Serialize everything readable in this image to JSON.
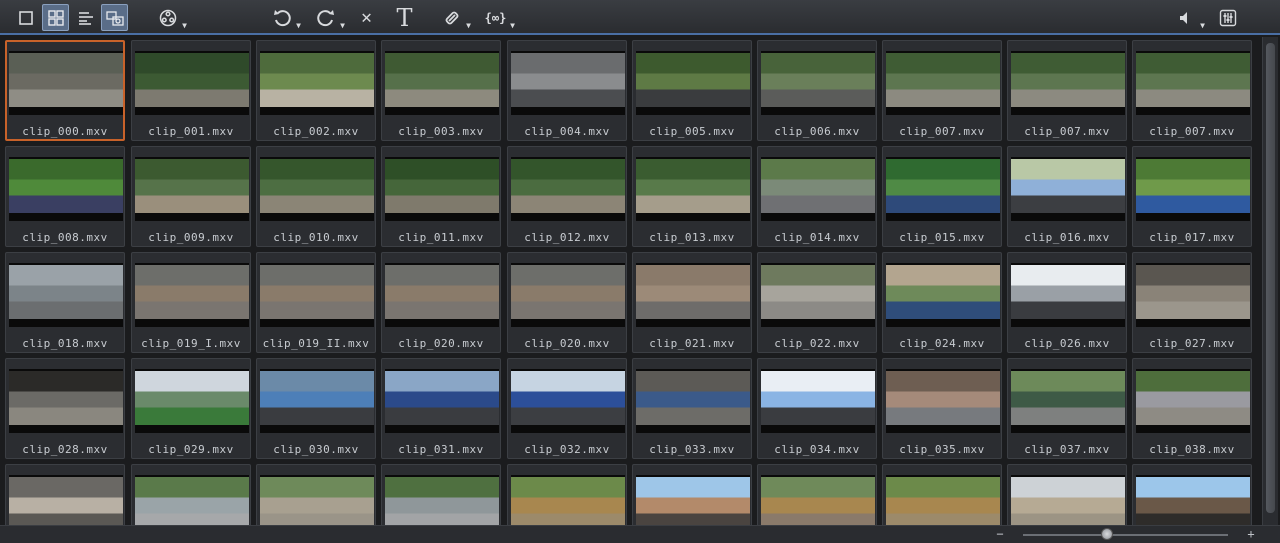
{
  "toolbar": {
    "left_icons": [
      {
        "name": "single-view-icon",
        "active": false
      },
      {
        "name": "grid-view-icon",
        "active": true
      },
      {
        "name": "list-view-icon",
        "active": false
      },
      {
        "name": "clip-view-icon",
        "active": true
      },
      {
        "name": "reel-menu-icon",
        "dropdown": true
      }
    ],
    "edit_icons": [
      {
        "name": "undo-icon",
        "dropdown": true
      },
      {
        "name": "redo-icon",
        "dropdown": true
      },
      {
        "name": "delete-icon"
      },
      {
        "name": "title-icon"
      },
      {
        "name": "tools-icon",
        "dropdown": true
      },
      {
        "name": "fx-icon",
        "dropdown": true
      }
    ],
    "right_icons": [
      {
        "name": "volume-icon",
        "dropdown": true
      },
      {
        "name": "settings-icon"
      }
    ],
    "title_glyph": "T",
    "delete_glyph": "✕",
    "fx_glyph": "{∞}"
  },
  "clips": [
    {
      "label": "clip_000.mxv",
      "selected": true
    },
    {
      "label": "clip_001.mxv"
    },
    {
      "label": "clip_002.mxv"
    },
    {
      "label": "clip_003.mxv"
    },
    {
      "label": "clip_004.mxv"
    },
    {
      "label": "clip_005.mxv"
    },
    {
      "label": "clip_006.mxv"
    },
    {
      "label": "clip_007.mxv"
    },
    {
      "label": "clip_007.mxv"
    },
    {
      "label": "clip_007.mxv"
    },
    {
      "label": "clip_008.mxv"
    },
    {
      "label": "clip_009.mxv"
    },
    {
      "label": "clip_010.mxv"
    },
    {
      "label": "clip_011.mxv"
    },
    {
      "label": "clip_012.mxv"
    },
    {
      "label": "clip_013.mxv"
    },
    {
      "label": "clip_014.mxv"
    },
    {
      "label": "clip_015.mxv"
    },
    {
      "label": "clip_016.mxv"
    },
    {
      "label": "clip_017.mxv"
    },
    {
      "label": "clip_018.mxv"
    },
    {
      "label": "clip_019_I.mxv"
    },
    {
      "label": "clip_019_II.mxv"
    },
    {
      "label": "clip_020.mxv"
    },
    {
      "label": "clip_020.mxv"
    },
    {
      "label": "clip_021.mxv"
    },
    {
      "label": "clip_022.mxv"
    },
    {
      "label": "clip_024.mxv"
    },
    {
      "label": "clip_026.mxv"
    },
    {
      "label": "clip_027.mxv"
    },
    {
      "label": "clip_028.mxv"
    },
    {
      "label": "clip_029.mxv"
    },
    {
      "label": "clip_030.mxv"
    },
    {
      "label": "clip_031.mxv"
    },
    {
      "label": "clip_032.mxv"
    },
    {
      "label": "clip_033.mxv"
    },
    {
      "label": "clip_034.mxv"
    },
    {
      "label": "clip_035.mxv"
    },
    {
      "label": "clip_037.mxv"
    },
    {
      "label": "clip_038.mxv"
    },
    {
      "label": ""
    },
    {
      "label": ""
    },
    {
      "label": ""
    },
    {
      "label": ""
    },
    {
      "label": ""
    },
    {
      "label": ""
    },
    {
      "label": ""
    },
    {
      "label": ""
    },
    {
      "label": ""
    },
    {
      "label": ""
    }
  ],
  "thumbnails": [
    {
      "sky": "#5a5f55",
      "mid": "#6b6a62",
      "ground": "#8f8d85"
    },
    {
      "sky": "#2f4a2a",
      "mid": "#3c5a33",
      "ground": "#7d7a70"
    },
    {
      "sky": "#4e6b3c",
      "mid": "#6d8a4f",
      "ground": "#b8b2a3"
    },
    {
      "sky": "#3f5a33",
      "mid": "#56704a",
      "ground": "#8d8a7e"
    },
    {
      "sky": "#6a6c6e",
      "mid": "#8a8c8e",
      "ground": "#4b4d50"
    },
    {
      "sky": "#3d5a2e",
      "mid": "#5e7a45",
      "ground": "#3a3c3e"
    },
    {
      "sky": "#48633a",
      "mid": "#6a7f5a",
      "ground": "#5b5c5a"
    },
    {
      "sky": "#3f5c34",
      "mid": "#5d7650",
      "ground": "#8c8a80"
    },
    {
      "sky": "#3f5c34",
      "mid": "#5d7650",
      "ground": "#8c8a80"
    },
    {
      "sky": "#3f5c34",
      "mid": "#5d7650",
      "ground": "#8c8a80"
    },
    {
      "sky": "#3a6a2c",
      "mid": "#4f8a3a",
      "ground": "#3a3f62"
    },
    {
      "sky": "#3c5a30",
      "mid": "#56734a",
      "ground": "#9a8f7c"
    },
    {
      "sky": "#35562c",
      "mid": "#4d6e42",
      "ground": "#8b8576"
    },
    {
      "sky": "#2e4f27",
      "mid": "#45663a",
      "ground": "#7f7a6c"
    },
    {
      "sky": "#33552b",
      "mid": "#4b6c40",
      "ground": "#8c8576"
    },
    {
      "sky": "#3a5c30",
      "mid": "#587a4a",
      "ground": "#a59d8b"
    },
    {
      "sky": "#5c7a4a",
      "mid": "#7b8a78",
      "ground": "#6f7073"
    },
    {
      "sky": "#2f6a30",
      "mid": "#4f8a45",
      "ground": "#2e4a7a"
    },
    {
      "sky": "#b9c8a6",
      "mid": "#8fb0d8",
      "ground": "#3c3e42"
    },
    {
      "sky": "#4d7a35",
      "mid": "#6f9a4a",
      "ground": "#2f5aa0"
    },
    {
      "sky": "#9aa2a8",
      "mid": "#7c8489",
      "ground": "#6b6e70"
    },
    {
      "sky": "#6d6e6a",
      "mid": "#8a7b6a",
      "ground": "#7a7570"
    },
    {
      "sky": "#6d6e6a",
      "mid": "#8a7b6a",
      "ground": "#7a7570"
    },
    {
      "sky": "#6d6e6a",
      "mid": "#8a7b6a",
      "ground": "#7a7570"
    },
    {
      "sky": "#6d6e6a",
      "mid": "#8a7b6a",
      "ground": "#7a7570"
    },
    {
      "sky": "#8a7a6a",
      "mid": "#9c8a78",
      "ground": "#6e6c6a"
    },
    {
      "sky": "#6e7a5e",
      "mid": "#a7a49c",
      "ground": "#8c8a86"
    },
    {
      "sky": "#b3a58f",
      "mid": "#6e8a5a",
      "ground": "#2f4d7a"
    },
    {
      "sky": "#e8ecef",
      "mid": "#9aa0a6",
      "ground": "#3a3c40"
    },
    {
      "sky": "#5a5650",
      "mid": "#8a8378",
      "ground": "#9b968c"
    },
    {
      "sky": "#2b2a28",
      "mid": "#6b6a66",
      "ground": "#8a877f"
    },
    {
      "sky": "#cfd6dd",
      "mid": "#6a8a6a",
      "ground": "#3a7a3a"
    },
    {
      "sky": "#6b8aa8",
      "mid": "#4d7fb8",
      "ground": "#3a3c40"
    },
    {
      "sky": "#8aa6c6",
      "mid": "#2b4a8a",
      "ground": "#3a3c40"
    },
    {
      "sky": "#c6d4e2",
      "mid": "#2c4f9a",
      "ground": "#3c3e42"
    },
    {
      "sky": "#5c5a56",
      "mid": "#3b5a8a",
      "ground": "#6d6c68"
    },
    {
      "sky": "#e9eef4",
      "mid": "#8ab4e4",
      "ground": "#3a3c40"
    },
    {
      "sky": "#6e5e52",
      "mid": "#a58a7a",
      "ground": "#777a7e"
    },
    {
      "sky": "#6d8a5a",
      "mid": "#3e5a46",
      "ground": "#7e807f"
    },
    {
      "sky": "#4e6e3c",
      "mid": "#9a9aa0",
      "ground": "#8e8b84"
    },
    {
      "sky": "#6a6864",
      "mid": "#b8b0a4",
      "ground": "#5a5854"
    },
    {
      "sky": "#5a7a4a",
      "mid": "#9aa4a8",
      "ground": "#a6a8aa"
    },
    {
      "sky": "#6e8a5a",
      "mid": "#a8a090",
      "ground": "#9a9488"
    },
    {
      "sky": "#4f7040",
      "mid": "#8f979a",
      "ground": "#a2a4a6"
    },
    {
      "sky": "#6c8a4a",
      "mid": "#a8874f",
      "ground": "#9c8a6a"
    },
    {
      "sky": "#9ec6e8",
      "mid": "#b38a6a",
      "ground": "#4a4440"
    },
    {
      "sky": "#6f8a5a",
      "mid": "#a8874f",
      "ground": "#8a7a6a"
    },
    {
      "sky": "#6c8a4a",
      "mid": "#a8874f",
      "ground": "#9c8a6a"
    },
    {
      "sky": "#cdd2d6",
      "mid": "#b6aa94",
      "ground": "#9c9484"
    },
    {
      "sky": "#9cc6ea",
      "mid": "#6a5848",
      "ground": "#2e2c2a"
    }
  ],
  "statusbar": {
    "zoom_minus": "−",
    "zoom_plus": "+",
    "zoom_level": 0.41
  }
}
